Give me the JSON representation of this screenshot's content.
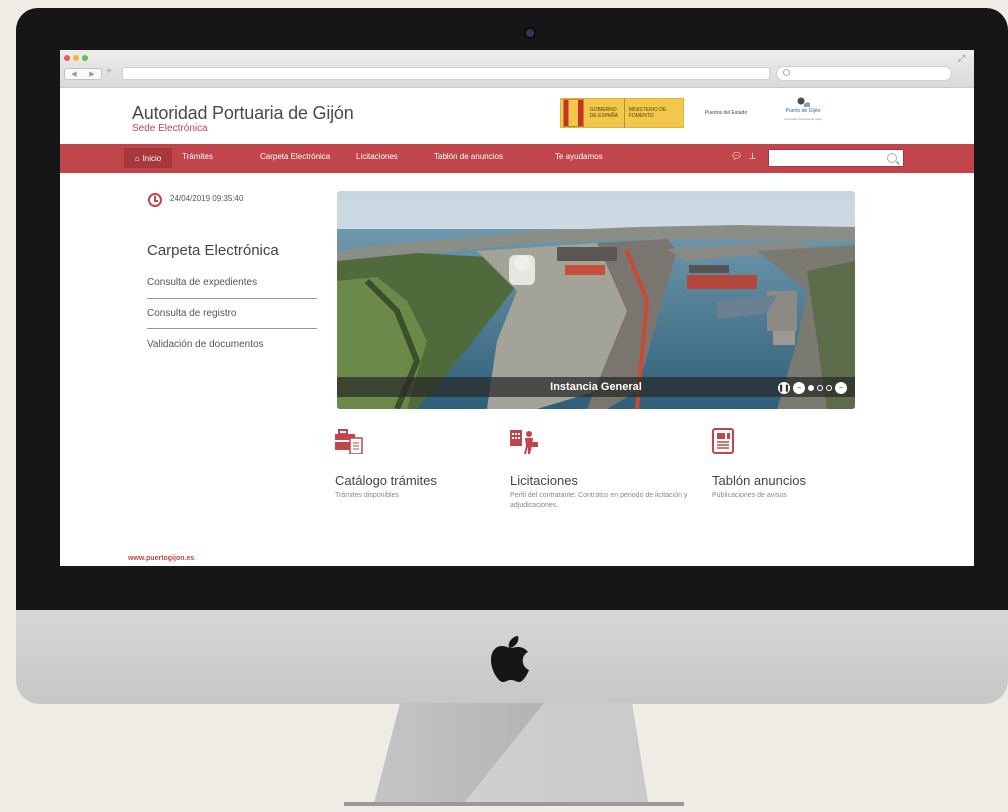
{
  "site": {
    "title": "Autoridad Portuaria de Gijón",
    "subtitle": "Sede Electrónica",
    "url": "www.puertogijon.es"
  },
  "logos": {
    "gobierno": "GOBIERNO DE ESPAÑA",
    "ministerio": "MINISTERIO DE FOMENTO",
    "puertos_estado": "Puertos del Estado",
    "puerto_gijon": "Puerto de Gijón",
    "puerto_gijon_sub": "Autoridad Portuaria de Gijón"
  },
  "nav": {
    "items": [
      "Inicio",
      "Trámites",
      "Carpeta Electrónica",
      "Licitaciones",
      "Tablón de anuncios",
      "Te ayudamos"
    ],
    "search_placeholder": ""
  },
  "sidebar": {
    "datetime": "24/04/2019 09:35:40",
    "title": "Carpeta Electrónica",
    "links": [
      "Consulta de expedientes",
      "Consulta de registro",
      "Validación de documentos"
    ]
  },
  "slider": {
    "caption": "Instancia General",
    "slide_count": 3,
    "active_index": 0
  },
  "features": [
    {
      "icon": "briefcase-icon",
      "title": "Catálogo trámites",
      "desc": "Trámites disponibles"
    },
    {
      "icon": "bidding-icon",
      "title": "Licitaciones",
      "desc": "Perfil del contratante: Contratos en periodo de licitación y adjudicaciones."
    },
    {
      "icon": "newspaper-icon",
      "title": "Tablón anuncios",
      "desc": "Publicaciones de avisos"
    }
  ],
  "colors": {
    "brand_red": "#c1464c",
    "nav_active": "#a9383d"
  }
}
